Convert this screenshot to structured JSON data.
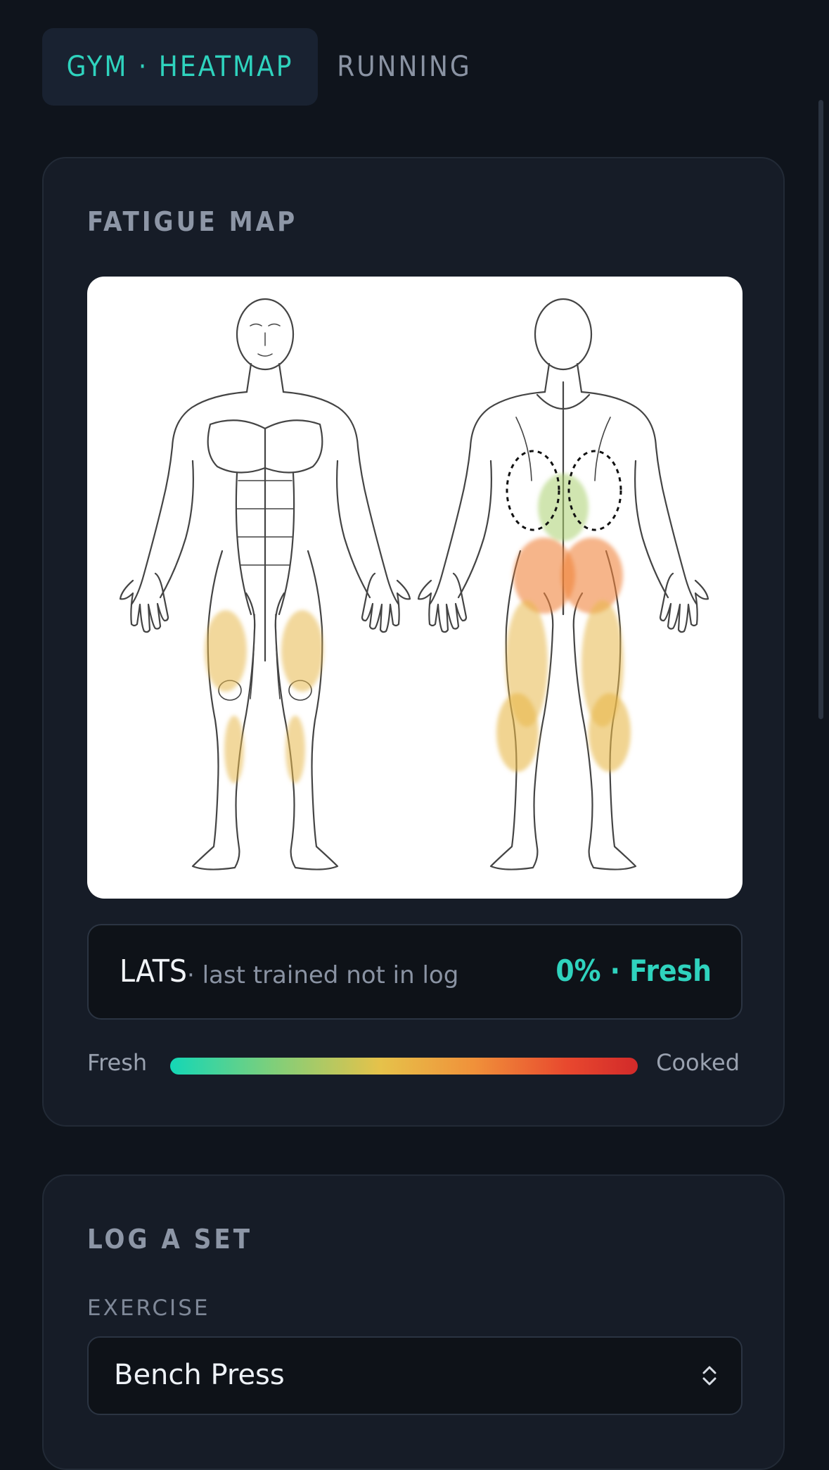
{
  "tabs": [
    {
      "label": "GYM · HEATMAP",
      "active": true
    },
    {
      "label": "RUNNING",
      "active": false
    }
  ],
  "fatigue": {
    "title": "FATIGUE MAP",
    "selected": {
      "muscle": "LATS",
      "detail": "· last trained not in log",
      "status": "0% · Fresh"
    },
    "legend": {
      "low": "Fresh",
      "high": "Cooked"
    }
  },
  "log": {
    "title": "LOG A SET",
    "exercise_label": "EXERCISE",
    "exercise_value": "Bench Press"
  },
  "colors": {
    "accent": "#2fd3be",
    "fatigue_low": "#14d7b6",
    "fatigue_mid": "#e6c24a",
    "fatigue_high": "#d22a2a"
  }
}
